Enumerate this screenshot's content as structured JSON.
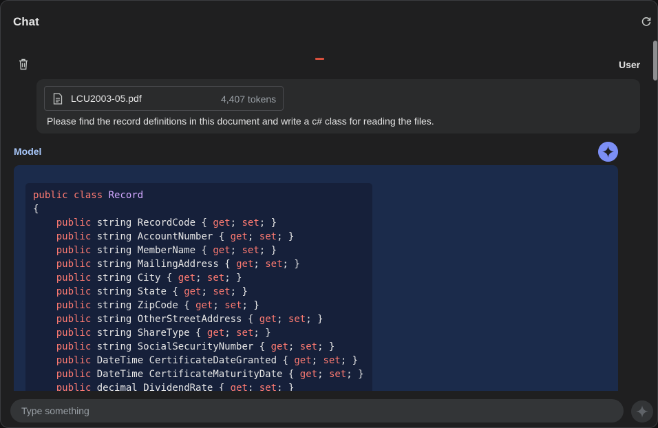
{
  "header": {
    "title": "Chat"
  },
  "user_turn": {
    "role_label": "User",
    "attachment": {
      "filename": "LCU2003-05.pdf",
      "tokens": "4,407 tokens"
    },
    "message": "Please find the record definitions in this document and write a c# class for reading the files."
  },
  "model_turn": {
    "role_label": "Model",
    "code_lines": [
      "public class Record",
      "{",
      "    public string RecordCode { get; set; }",
      "    public string AccountNumber { get; set; }",
      "    public string MemberName { get; set; }",
      "    public string MailingAddress { get; set; }",
      "    public string City { get; set; }",
      "    public string State { get; set; }",
      "    public string ZipCode { get; set; }",
      "    public string OtherStreetAddress { get; set; }",
      "    public string ShareType { get; set; }",
      "    public string SocialSecurityNumber { get; set; }",
      "    public DateTime CertificateDateGranted { get; set; }",
      "    public DateTime CertificateMaturityDate { get; set; }",
      "    public decimal DividendRate { get; set; }"
    ]
  },
  "composer": {
    "placeholder": "Type something"
  },
  "icons": {
    "refresh": "refresh-icon",
    "trash": "trash-icon",
    "file": "document-icon",
    "model": "sparkle-icon",
    "send": "sparkle-icon"
  },
  "colors": {
    "accent_model": "#a8c7fa",
    "model_bubble": "#1b2b4b",
    "code_keyword": "#ff7b72",
    "code_class": "#d2a8ff",
    "record_indicator": "#d8503d"
  }
}
